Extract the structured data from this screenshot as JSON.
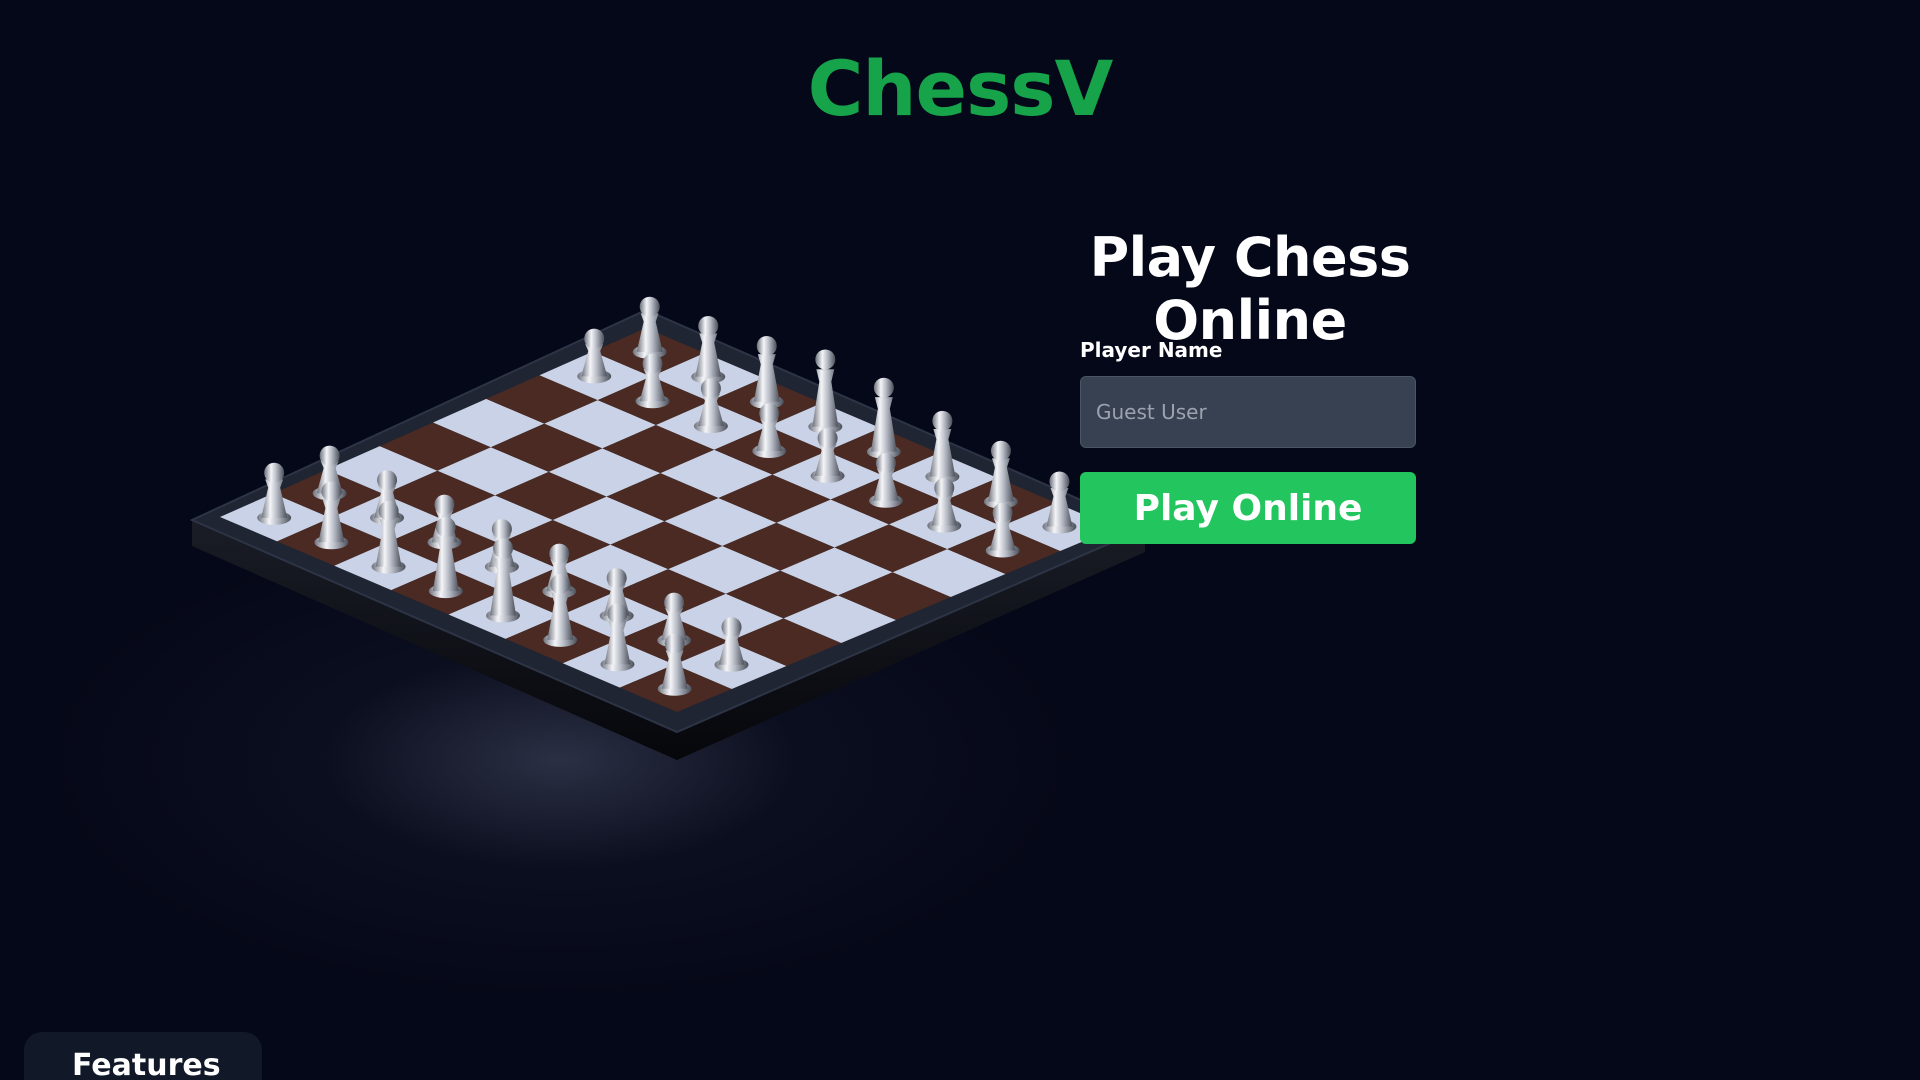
{
  "header": {
    "logo": "ChessV"
  },
  "hero": {
    "title": "Play Chess Online",
    "board_image": "isometric-3d-chessboard-with-metal-pieces"
  },
  "form": {
    "player_label": "Player Name",
    "player_placeholder": "Guest User",
    "player_value": "",
    "play_button": "Play Online"
  },
  "features": {
    "tab_label": "Features"
  },
  "colors": {
    "background": "#050818",
    "brand": "#16a34a",
    "button": "#22c55e",
    "input_bg": "#374151",
    "board_light": "#c9d2e6",
    "board_dark": "#4a2a22"
  }
}
